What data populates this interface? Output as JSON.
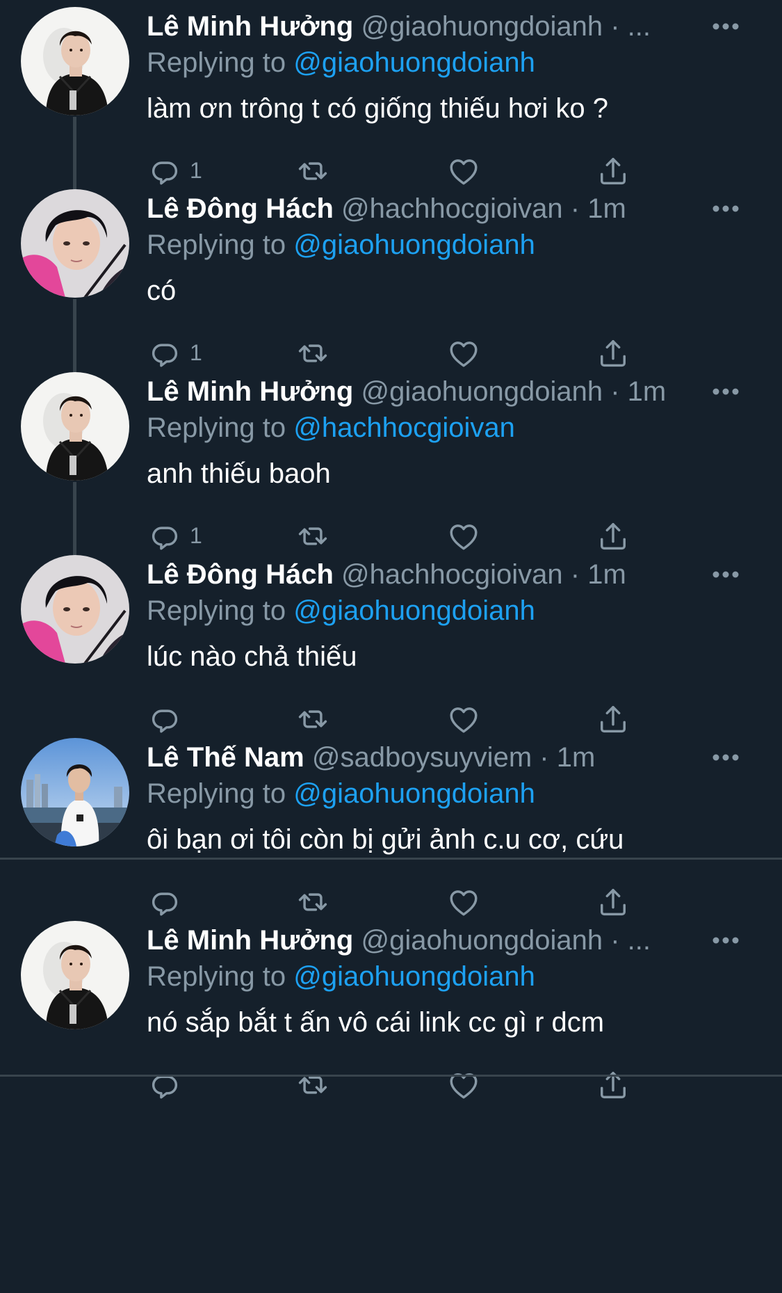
{
  "tweets": [
    {
      "name": "Lê Minh Hưởng",
      "handle": "@giaohuongdoianh",
      "sep": "·",
      "time": "...",
      "replying_prefix": "Replying to",
      "replying_to": "@giaohuongdoianh",
      "text": "làm ơn trông t có giống thiếu hơi ko ?",
      "reply_count": "1",
      "avatar": "hoodie"
    },
    {
      "name": "Lê Đông Hách",
      "handle": "@hachhocgioivan",
      "sep": "·",
      "time": "1m",
      "replying_prefix": "Replying to",
      "replying_to": "@giaohuongdoianh",
      "text": "có",
      "reply_count": "1",
      "avatar": "pink"
    },
    {
      "name": "Lê Minh Hưởng",
      "handle": "@giaohuongdoianh",
      "sep": "·",
      "time": "1m",
      "replying_prefix": "Replying to",
      "replying_to": "@hachhocgioivan",
      "text": "anh thiếu baoh",
      "reply_count": "1",
      "avatar": "hoodie"
    },
    {
      "name": "Lê Đông Hách",
      "handle": "@hachhocgioivan",
      "sep": "·",
      "time": "1m",
      "replying_prefix": "Replying to",
      "replying_to": "@giaohuongdoianh",
      "text": "lúc nào chả thiếu",
      "reply_count": "",
      "avatar": "pink"
    },
    {
      "name": "Lê Thế Nam",
      "handle": "@sadboysuyviem",
      "sep": "·",
      "time": "1m",
      "replying_prefix": "Replying to",
      "replying_to": "@giaohuongdoianh",
      "text": "ôi bạn ơi tôi còn bị gửi ảnh c.u cơ, cứu",
      "reply_count": "",
      "avatar": "beach"
    },
    {
      "name": "Lê Minh Hưởng",
      "handle": "@giaohuongdoianh",
      "sep": "·",
      "time": "...",
      "replying_prefix": "Replying to",
      "replying_to": "@giaohuongdoianh",
      "text": "nó sắp bắt t ấn vô cái link cc gì r dcm",
      "reply_count": "",
      "avatar": "hoodie"
    }
  ],
  "icons": {
    "more": "more-horizontal-icon",
    "reply": "reply-bubble-icon",
    "retweet": "retweet-icon",
    "like": "heart-icon",
    "share": "share-upload-icon"
  },
  "colors": {
    "background": "#15202b",
    "text_primary": "#ffffff",
    "text_secondary": "#8899a6",
    "accent": "#1da1f2",
    "divider": "#38444d"
  }
}
